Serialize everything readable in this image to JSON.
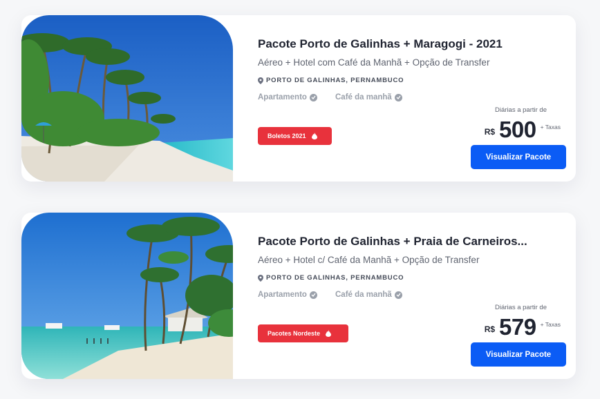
{
  "packages": [
    {
      "title": "Pacote Porto de Galinhas + Maragogi - 2021",
      "subtitle": "Aéreo + Hotel com Café da Manhã + Opção de Transfer",
      "location": "PORTO DE GALINHAS, PERNAMBUCO",
      "features": [
        "Apartamento",
        "Café da manhã"
      ],
      "badge": "Boletos 2021",
      "price_caption": "Diárias a partir de",
      "currency": "R$",
      "price": "500",
      "taxes": "+ Taxas",
      "button": "Visualizar Pacote",
      "icons": {
        "location": "map-pin-icon",
        "feature": "check-circle-icon",
        "badge": "fire-icon"
      }
    },
    {
      "title": "Pacote Porto de Galinhas + Praia de Carneiros...",
      "subtitle": "Aéreo + Hotel c/ Café da Manhã + Opção de Transfer",
      "location": "PORTO DE GALINHAS, PERNAMBUCO",
      "features": [
        "Apartamento",
        "Café da manhã"
      ],
      "badge": "Pacotes Nordeste",
      "price_caption": "Diárias a partir de",
      "currency": "R$",
      "price": "579",
      "taxes": "+ Taxas",
      "button": "Visualizar Pacote",
      "icons": {
        "location": "map-pin-icon",
        "feature": "check-circle-icon",
        "badge": "fire-icon"
      }
    }
  ],
  "colors": {
    "accent": "#0b5cf5",
    "badge": "#e8323c",
    "title": "#1f2330",
    "muted": "#9aa0aa"
  }
}
